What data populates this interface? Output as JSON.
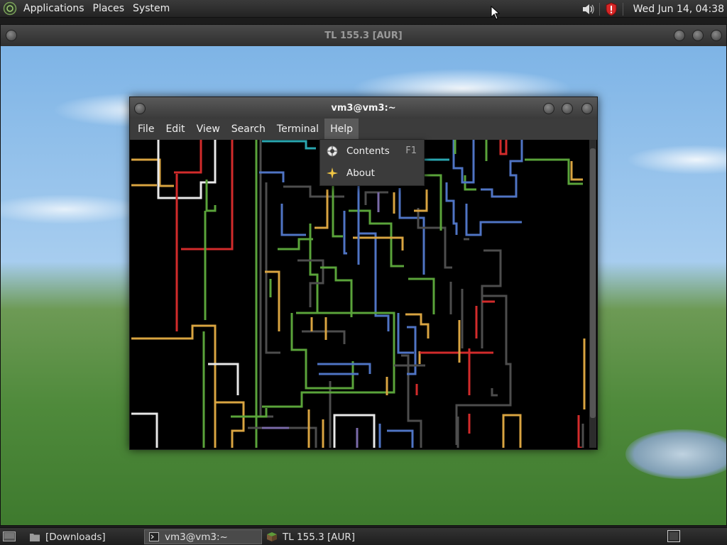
{
  "top_panel": {
    "menus": [
      "Applications",
      "Places",
      "System"
    ],
    "clock": "Wed Jun 14, 04:38",
    "tray_icons": [
      "volume-icon",
      "shield-alert-icon"
    ]
  },
  "outer_window": {
    "title": "TL 155.3 [AUR]"
  },
  "terminal": {
    "title": "vm3@vm3:~",
    "menu": [
      "File",
      "Edit",
      "View",
      "Search",
      "Terminal",
      "Help"
    ],
    "active_menu": "Help"
  },
  "help_menu": {
    "items": [
      {
        "label": "Contents",
        "accel": "F1",
        "icon": "help-lifebuoy-icon"
      },
      {
        "label": "About",
        "accel": "",
        "icon": "about-star-icon"
      }
    ]
  },
  "taskbar": {
    "items": [
      {
        "label": "[Downloads]",
        "icon": "folder-icon"
      },
      {
        "label": "vm3@vm3:~",
        "icon": "terminal-icon",
        "active": true
      },
      {
        "label": "TL 155.3 [AUR]",
        "icon": "minecraft-block-icon"
      }
    ]
  },
  "colors": {
    "pipe_green": "#5aa33a",
    "pipe_red": "#d22b2b",
    "pipe_yellow": "#d9a441",
    "pipe_blue": "#4f74c4",
    "pipe_white": "#e8e8e8",
    "pipe_gray": "#4d4d4d",
    "pipe_cyan": "#2aa6b0",
    "pipe_purple": "#7a6aa8"
  }
}
